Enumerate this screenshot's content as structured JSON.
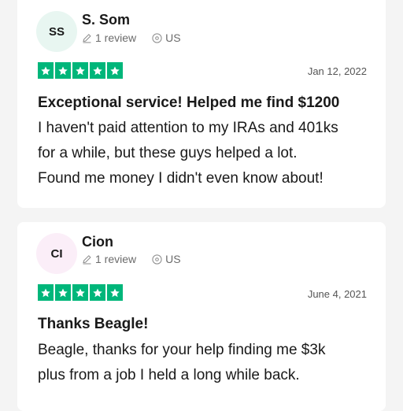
{
  "reviews": [
    {
      "initials": "SS",
      "name": "S. Som",
      "review_count": "1 review",
      "country": "US",
      "rating": 5,
      "date": "Jan 12, 2022",
      "title": "Exceptional service! Helped me find $1200",
      "body": [
        "I haven't paid attention to my IRAs and 401ks",
        "for a while, but these guys helped a lot.",
        "Found me money I didn't even know about!"
      ]
    },
    {
      "initials": "CI",
      "name": "Cion",
      "review_count": "1 review",
      "country": "US",
      "rating": 5,
      "date": "June 4, 2021",
      "title": "Thanks Beagle!",
      "body": [
        "Beagle, thanks for your help finding me $3k",
        "plus from a job I held a long while back."
      ]
    }
  ],
  "colors": {
    "star_green": "#00b67a",
    "avatar_green_bg": "#e8f6f1",
    "avatar_pink_bg": "#fbeef8"
  },
  "icons": {
    "review_count": "pencil-icon",
    "location": "location-pin-icon",
    "rating": "star-icon"
  }
}
